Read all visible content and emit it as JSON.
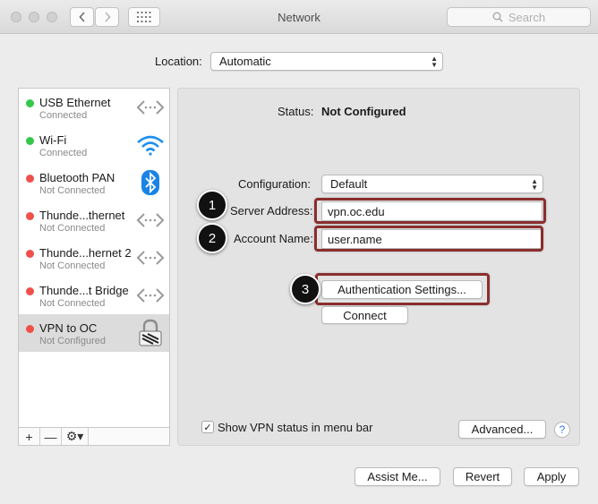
{
  "window": {
    "title": "Network"
  },
  "toolbar": {
    "back_icon": "chevron-left-icon",
    "forward_icon": "chevron-right-icon",
    "grid_icon": "grid-icon",
    "search_placeholder": "Search"
  },
  "location": {
    "label": "Location:",
    "value": "Automatic"
  },
  "services": [
    {
      "name": "USB Ethernet",
      "status": "Connected",
      "status_color": "#34c84a",
      "icon": "ethernet-arrows-icon"
    },
    {
      "name": "Wi-Fi",
      "status": "Connected",
      "status_color": "#34c84a",
      "icon": "wifi-icon"
    },
    {
      "name": "Bluetooth PAN",
      "status": "Not Connected",
      "status_color": "#f0504a",
      "icon": "bluetooth-icon"
    },
    {
      "name": "Thunde...thernet",
      "status": "Not Connected",
      "status_color": "#f0504a",
      "icon": "ethernet-arrows-icon"
    },
    {
      "name": "Thunde...hernet 2",
      "status": "Not Connected",
      "status_color": "#f0504a",
      "icon": "ethernet-arrows-icon"
    },
    {
      "name": "Thunde...t Bridge",
      "status": "Not Connected",
      "status_color": "#f0504a",
      "icon": "ethernet-arrows-icon"
    },
    {
      "name": "VPN to OC",
      "status": "Not Configured",
      "status_color": "#f0504a",
      "icon": "vpn-lock-icon",
      "selected": true
    }
  ],
  "sidebar_tools": {
    "add": "+",
    "remove": "—",
    "gear": "⚙▾"
  },
  "detail": {
    "status_label": "Status:",
    "status_value": "Not Configured",
    "configuration_label": "Configuration:",
    "configuration_value": "Default",
    "server_address_label": "Server Address:",
    "server_address_value": "vpn.oc.edu",
    "account_name_label": "Account Name:",
    "account_name_value": "user.name",
    "auth_settings_button": "Authentication Settings...",
    "connect_button": "Connect",
    "show_vpn_checkbox_label": "Show VPN status in menu bar",
    "show_vpn_checked": true,
    "advanced_button": "Advanced...",
    "help_glyph": "?"
  },
  "callouts": [
    "1",
    "2",
    "3"
  ],
  "highlight_color": "#8a2e2e",
  "footer": {
    "assist_button": "Assist Me...",
    "revert_button": "Revert",
    "apply_button": "Apply"
  }
}
